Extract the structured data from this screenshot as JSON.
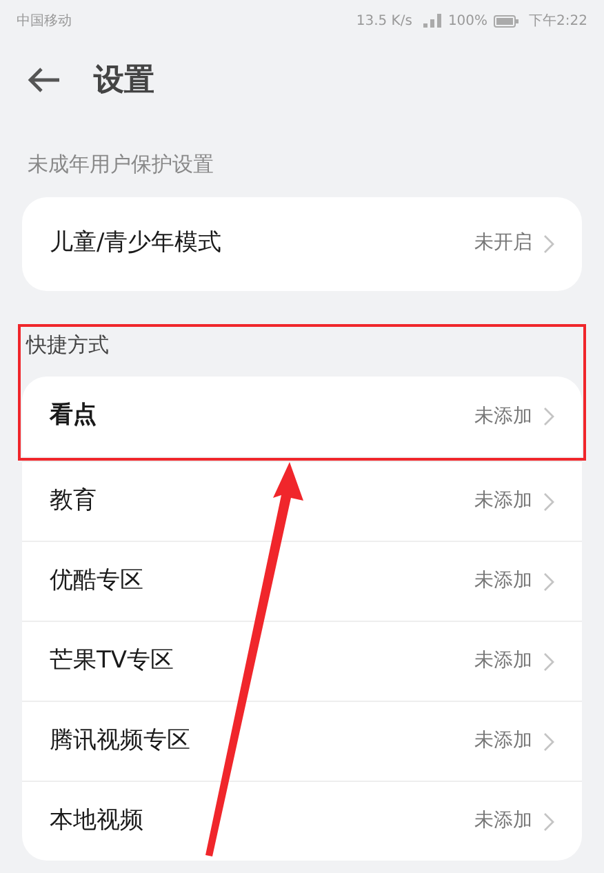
{
  "status_bar": {
    "carrier": "中国移动",
    "speed": "13.5 K/s",
    "battery": "100%",
    "time": "下午2:22"
  },
  "header": {
    "title": "设置"
  },
  "sections": [
    {
      "title": "未成年用户保护设置",
      "highlighted": false,
      "items": [
        {
          "label": "儿童/青少年模式",
          "value": "未开启",
          "highlighted": false
        }
      ]
    },
    {
      "title": "快捷方式",
      "highlighted": true,
      "items": [
        {
          "label": "看点",
          "value": "未添加",
          "highlighted": true
        },
        {
          "label": "教育",
          "value": "未添加",
          "highlighted": false
        },
        {
          "label": "优酷专区",
          "value": "未添加",
          "highlighted": false
        },
        {
          "label": "芒果TV专区",
          "value": "未添加",
          "highlighted": false
        },
        {
          "label": "腾讯视频专区",
          "value": "未添加",
          "highlighted": false
        },
        {
          "label": "本地视频",
          "value": "未添加",
          "highlighted": false
        }
      ]
    }
  ]
}
